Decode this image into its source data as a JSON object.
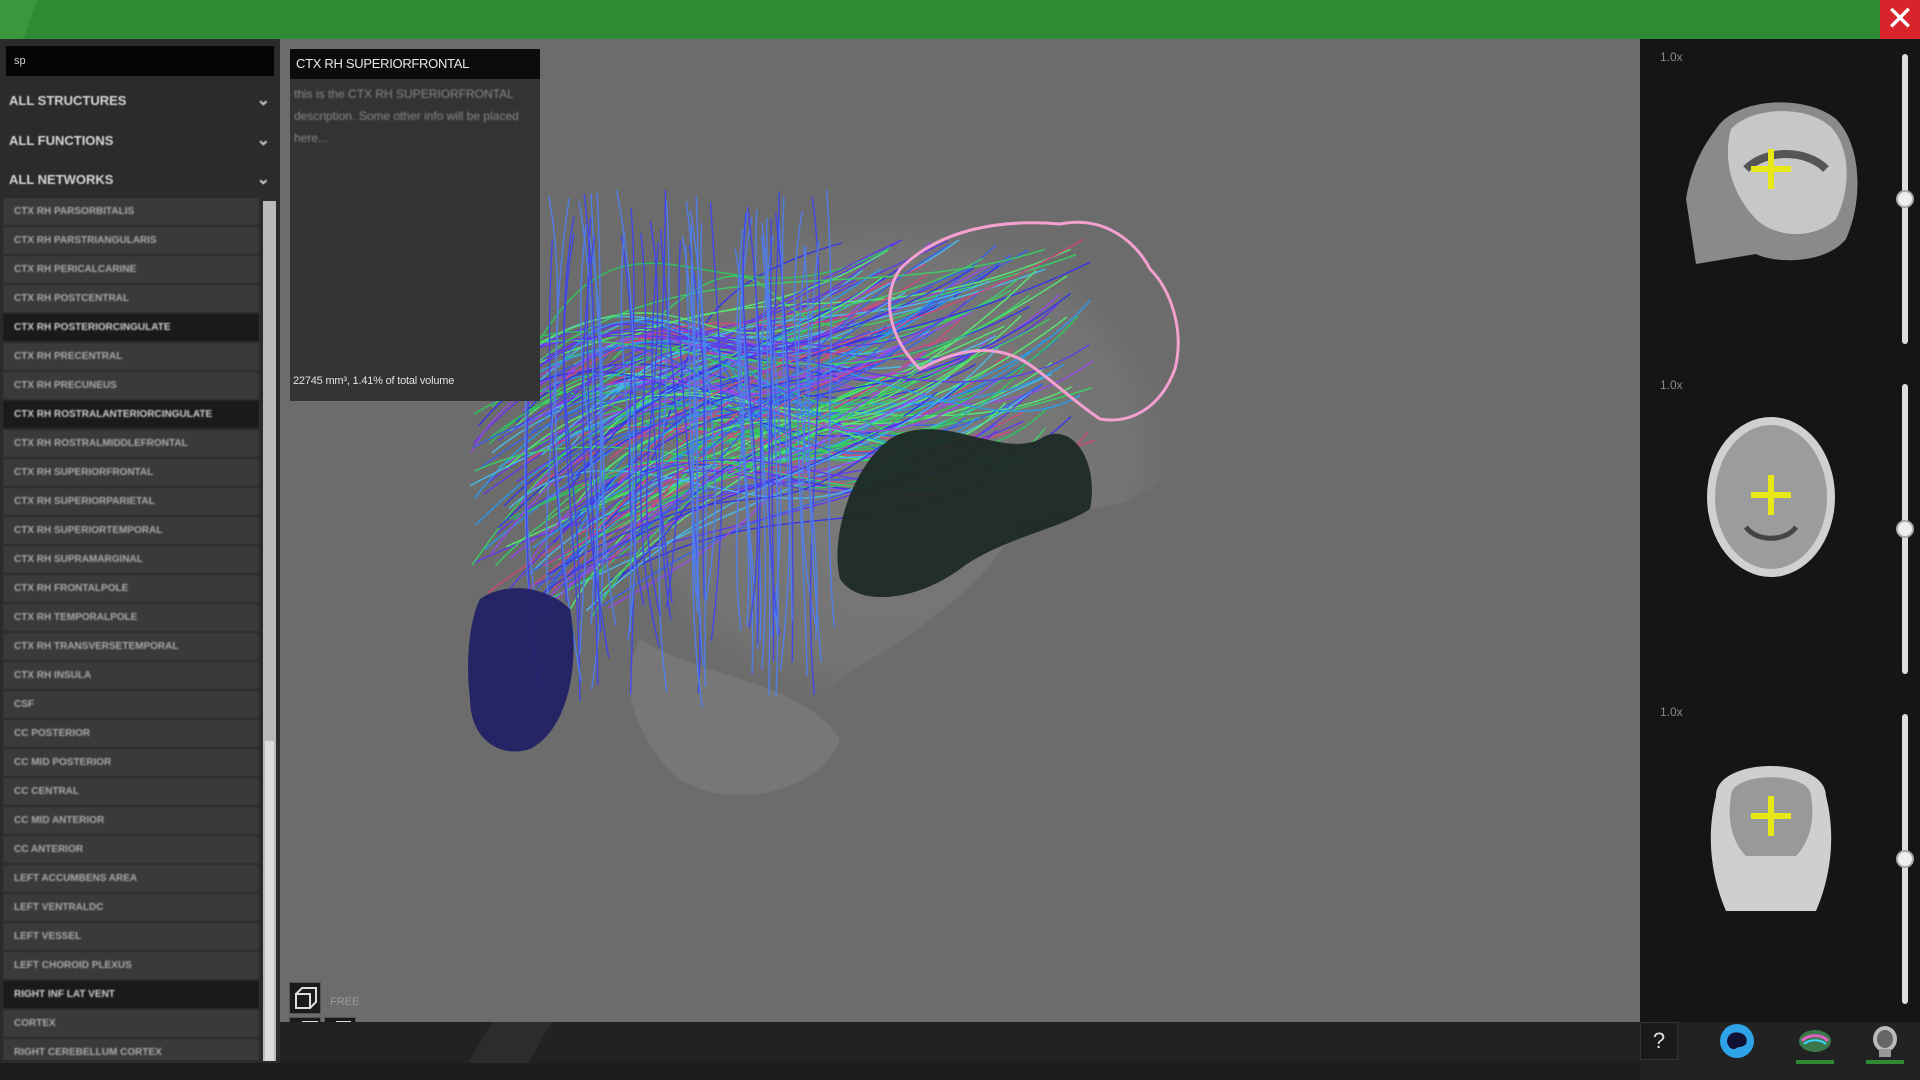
{
  "header": {
    "close_icon": "close-x-icon",
    "accent_color": "#2f8a34"
  },
  "sidebar": {
    "search_value": "sp",
    "dropdowns": [
      {
        "label": "ALL STRUCTURES"
      },
      {
        "label": "ALL FUNCTIONS"
      },
      {
        "label": "ALL NETWORKS"
      }
    ],
    "items": [
      {
        "label": "CTX RH PARSORBITALIS",
        "selected": false
      },
      {
        "label": "CTX RH PARSTRIANGULARIS",
        "selected": false
      },
      {
        "label": "CTX RH PERICALCARINE",
        "selected": false
      },
      {
        "label": "CTX RH POSTCENTRAL",
        "selected": false
      },
      {
        "label": "CTX RH POSTERIORCINGULATE",
        "selected": true
      },
      {
        "label": "CTX RH PRECENTRAL",
        "selected": false
      },
      {
        "label": "CTX RH PRECUNEUS",
        "selected": false
      },
      {
        "label": "CTX RH ROSTRALANTERIORCINGULATE",
        "selected": true
      },
      {
        "label": "CTX RH ROSTRALMIDDLEFRONTAL",
        "selected": false
      },
      {
        "label": "CTX RH SUPERIORFRONTAL",
        "selected": false
      },
      {
        "label": "CTX RH SUPERIORPARIETAL",
        "selected": false
      },
      {
        "label": "CTX RH SUPERIORTEMPORAL",
        "selected": false
      },
      {
        "label": "CTX RH SUPRAMARGINAL",
        "selected": false
      },
      {
        "label": "CTX RH FRONTALPOLE",
        "selected": false
      },
      {
        "label": "CTX RH TEMPORALPOLE",
        "selected": false
      },
      {
        "label": "CTX RH TRANSVERSETEMPORAL",
        "selected": false
      },
      {
        "label": "CTX RH INSULA",
        "selected": false
      },
      {
        "label": "CSF",
        "selected": false
      },
      {
        "label": "CC POSTERIOR",
        "selected": false
      },
      {
        "label": "CC MID POSTERIOR",
        "selected": false
      },
      {
        "label": "CC CENTRAL",
        "selected": false
      },
      {
        "label": "CC MID ANTERIOR",
        "selected": false
      },
      {
        "label": "CC ANTERIOR",
        "selected": false
      },
      {
        "label": "LEFT ACCUMBENS AREA",
        "selected": false
      },
      {
        "label": "LEFT VENTRALDC",
        "selected": false
      },
      {
        "label": "LEFT VESSEL",
        "selected": false
      },
      {
        "label": "LEFT CHOROID PLEXUS",
        "selected": false
      },
      {
        "label": "RIGHT INF LAT VENT",
        "selected": true
      },
      {
        "label": "CORTEX",
        "selected": false
      },
      {
        "label": "RIGHT CEREBELLUM CORTEX",
        "selected": false
      }
    ]
  },
  "info": {
    "title": "CTX RH SUPERIORFRONTAL",
    "description": "this is the CTX RH SUPERIORFRONTAL description. Some other info will be placed here...",
    "volume": "22745 mm³, 1.41% of total volume"
  },
  "view_controls": {
    "free_label": "FREE",
    "icons": [
      "perspective-cube-icon",
      "front-view-cube-icon",
      "side-view-cube-icon"
    ]
  },
  "slices": [
    {
      "zoom": "1.0x",
      "view": "sagittal",
      "slider_level": 0.5
    },
    {
      "zoom": "1.0x",
      "view": "axial",
      "slider_level": 0.5
    },
    {
      "zoom": "1.0x",
      "view": "coronal",
      "slider_level": 0.5
    }
  ],
  "bottom_icons": {
    "help": "?",
    "icons": [
      "help-icon",
      "brain-globe-icon",
      "tractography-brain-icon",
      "mri-head-icon"
    ]
  }
}
